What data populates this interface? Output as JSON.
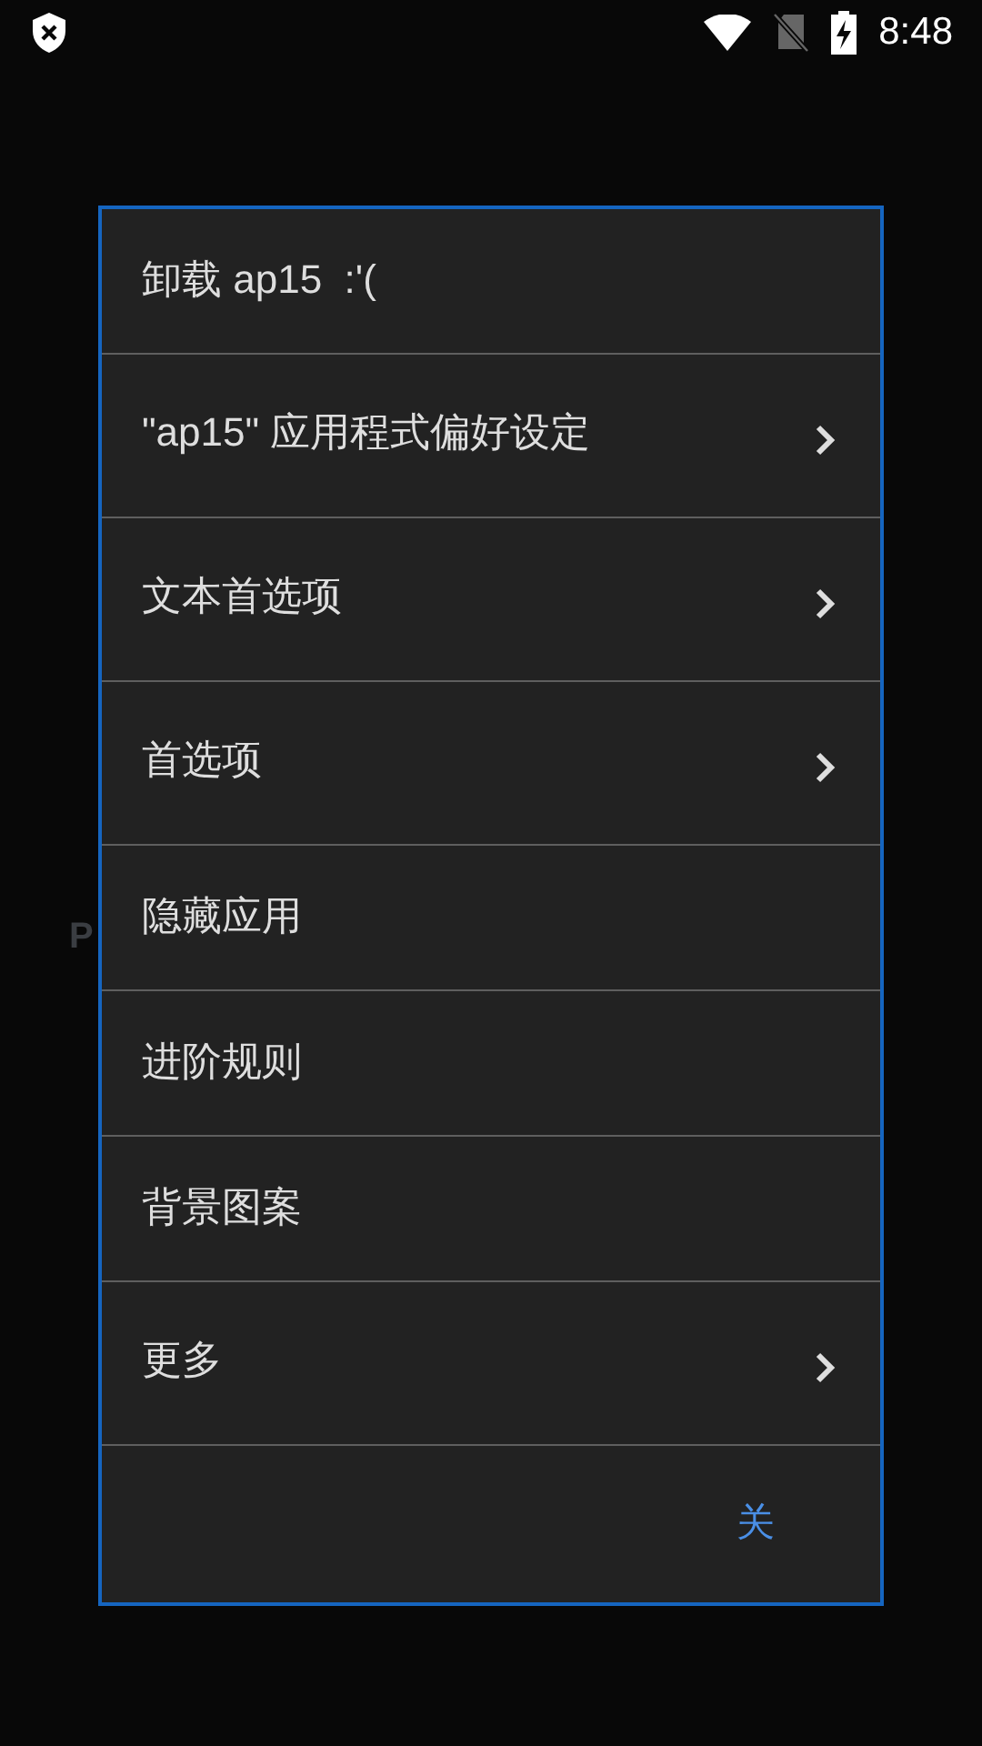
{
  "status_bar": {
    "time": "8:48"
  },
  "background_text": "P",
  "menu": {
    "items": [
      {
        "label": "卸载 ap15  :'(",
        "submenu": false
      },
      {
        "label": "\"ap15\" 应用程式偏好设定",
        "submenu": true
      },
      {
        "label": "文本首选项",
        "submenu": true
      },
      {
        "label": "首选项",
        "submenu": true
      },
      {
        "label": "隐藏应用",
        "submenu": false
      },
      {
        "label": "进阶规则",
        "submenu": false
      },
      {
        "label": "背景图案",
        "submenu": false
      },
      {
        "label": "更多",
        "submenu": true
      }
    ],
    "close_button": "关"
  }
}
